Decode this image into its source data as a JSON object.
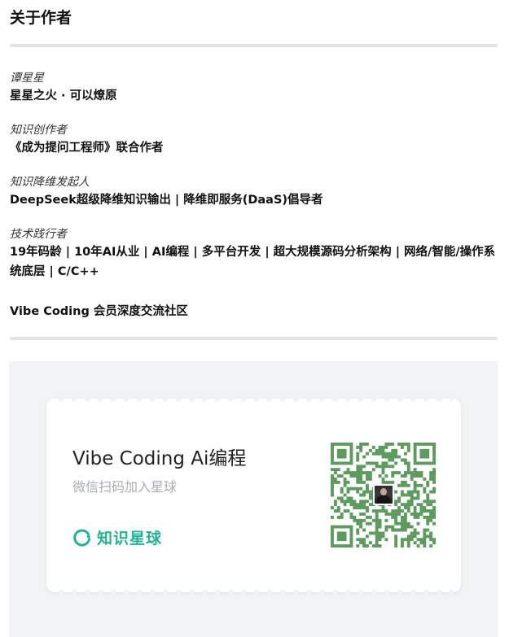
{
  "section": {
    "title": "关于作者"
  },
  "author": {
    "items": [
      {
        "role": "谭星星",
        "desc": "星星之火 · 可以燎原"
      },
      {
        "role": "知识创作者",
        "desc": "《成为提问工程师》联合作者"
      },
      {
        "role": "知识降维发起人",
        "desc": "DeepSeek超级降维知识输出 | 降维即服务(DaaS)倡导者"
      },
      {
        "role": "技术践行者",
        "desc": "19年码龄 | 10年AI从业 | AI编程 | 多平台开发 | 超大规模源码分析架构 | 网络/智能/操作系统底层 | C/C++"
      }
    ],
    "community": "Vibe Coding 会员深度交流社区"
  },
  "promo": {
    "title": "Vibe Coding Ai编程",
    "subtitle": "微信扫码加入星球",
    "brand_name": "知识星球",
    "brand_icon": "planet-ring-icon",
    "brand_color": "#1fb493",
    "qr_color": "#5e9b5e",
    "qr_label": "qr-code"
  }
}
